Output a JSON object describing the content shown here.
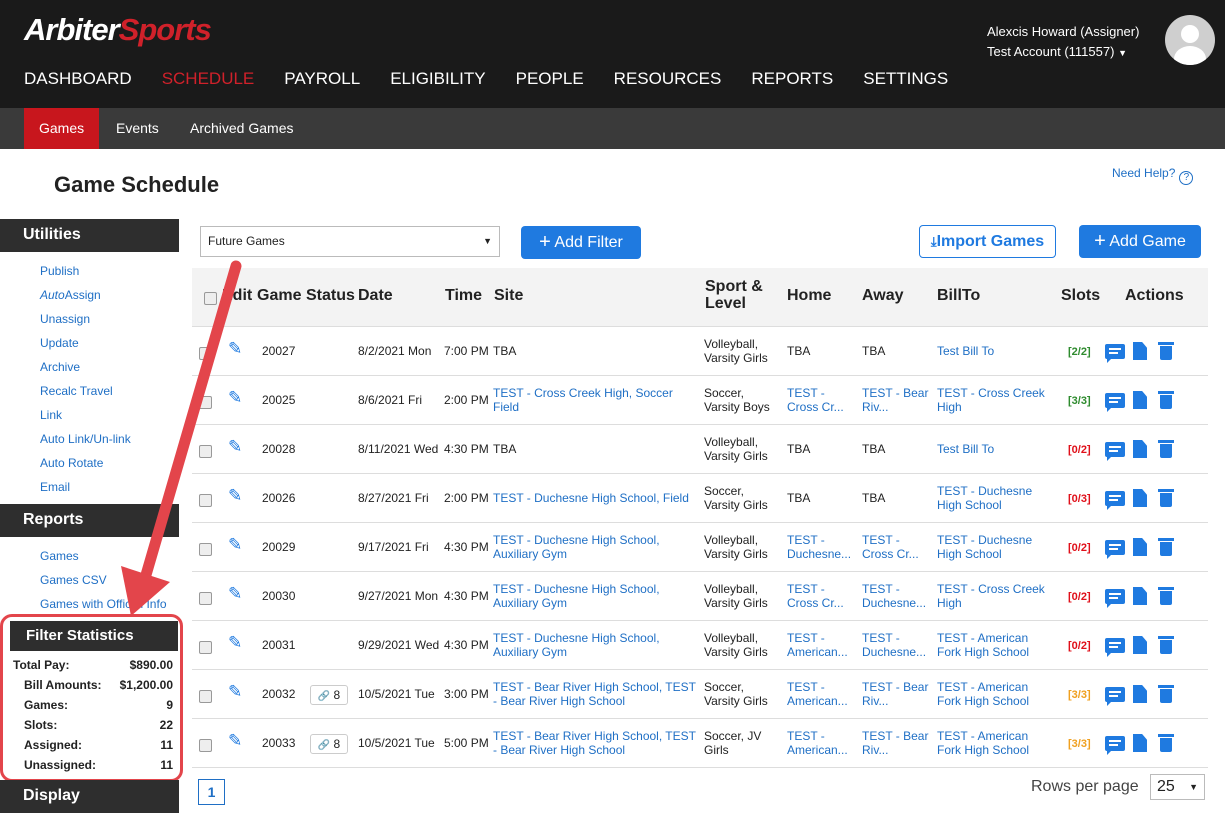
{
  "logo": {
    "arbiter": "Arbiter",
    "sports": "Sports"
  },
  "user": {
    "name": "Alexcis Howard (Assigner)",
    "account": "Test Account (111557)"
  },
  "nav": [
    "DASHBOARD",
    "SCHEDULE",
    "PAYROLL",
    "ELIGIBILITY",
    "PEOPLE",
    "RESOURCES",
    "REPORTS",
    "SETTINGS"
  ],
  "subnav": [
    "Games",
    "Events",
    "Archived Games"
  ],
  "page_title": "Game Schedule",
  "help": "Need Help?",
  "utilities": {
    "title": "Utilities",
    "items": [
      "Publish",
      "AutoAssign",
      "Unassign",
      "Update",
      "Archive",
      "Recalc Travel",
      "Link",
      "Auto Link/Un-link",
      "Auto Rotate",
      "Email"
    ]
  },
  "reports": {
    "title": "Reports",
    "items": [
      "Games",
      "Games CSV",
      "Games with Official Info"
    ]
  },
  "stats": {
    "title": "Filter Statistics",
    "rows": [
      {
        "label": "Total Pay:",
        "value": "$890.00"
      },
      {
        "label": "Bill Amounts:",
        "value": "$1,200.00"
      },
      {
        "label": "Games:",
        "value": "9"
      },
      {
        "label": "Slots:",
        "value": "22"
      },
      {
        "label": "Assigned:",
        "value": "11"
      },
      {
        "label": "Unassigned:",
        "value": "11"
      }
    ]
  },
  "display": "Display",
  "filter": {
    "selected": "Future Games",
    "add_filter": "Add Filter",
    "import_games": "Import Games",
    "add_game": "Add Game"
  },
  "columns": [
    "Edit",
    "Game",
    "Status",
    "Date",
    "Time",
    "Site",
    "Sport & Level",
    "Home",
    "Away",
    "BillTo",
    "Slots",
    "Actions"
  ],
  "rows": [
    {
      "game": "20027",
      "status": "",
      "date": "8/2/2021 Mon",
      "time": "7:00 PM",
      "site": "TBA",
      "site_link": false,
      "sport": "Volleyball, Varsity Girls",
      "home": "TBA",
      "home_link": false,
      "away": "TBA",
      "away_link": false,
      "billto": "Test Bill To",
      "slots": "[2/2]",
      "slots_color": "#2e8b2e"
    },
    {
      "game": "20025",
      "status": "",
      "date": "8/6/2021 Fri",
      "time": "2:00 PM",
      "site": "TEST - Cross Creek High, Soccer Field",
      "site_link": true,
      "sport": "Soccer, Varsity Boys",
      "home": "TEST - Cross Cr...",
      "home_link": true,
      "away": "TEST - Bear Riv...",
      "away_link": true,
      "billto": "TEST - Cross Creek High",
      "slots": "[3/3]",
      "slots_color": "#2e8b2e"
    },
    {
      "game": "20028",
      "status": "",
      "date": "8/11/2021 Wed",
      "time": "4:30 PM",
      "site": "TBA",
      "site_link": false,
      "sport": "Volleyball, Varsity Girls",
      "home": "TBA",
      "home_link": false,
      "away": "TBA",
      "away_link": false,
      "billto": "Test Bill To",
      "slots": "[0/2]",
      "slots_color": "#e0101a"
    },
    {
      "game": "20026",
      "status": "",
      "date": "8/27/2021 Fri",
      "time": "2:00 PM",
      "site": "TEST - Duchesne High School, Field",
      "site_link": true,
      "sport": "Soccer, Varsity Girls",
      "home": "TBA",
      "home_link": false,
      "away": "TBA",
      "away_link": false,
      "billto": "TEST - Duchesne High School",
      "slots": "[0/3]",
      "slots_color": "#e0101a"
    },
    {
      "game": "20029",
      "status": "",
      "date": "9/17/2021 Fri",
      "time": "4:30 PM",
      "site": "TEST - Duchesne High School, Auxiliary Gym",
      "site_link": true,
      "sport": "Volleyball, Varsity Girls",
      "home": "TEST - Duchesne...",
      "home_link": true,
      "away": "TEST - Cross Cr...",
      "away_link": true,
      "billto": "TEST - Duchesne High School",
      "slots": "[0/2]",
      "slots_color": "#e0101a"
    },
    {
      "game": "20030",
      "status": "",
      "date": "9/27/2021 Mon",
      "time": "4:30 PM",
      "site": "TEST - Duchesne High School, Auxiliary Gym",
      "site_link": true,
      "sport": "Volleyball, Varsity Girls",
      "home": "TEST - Cross Cr...",
      "home_link": true,
      "away": "TEST - Duchesne...",
      "away_link": true,
      "billto": "TEST - Cross Creek High",
      "slots": "[0/2]",
      "slots_color": "#e0101a"
    },
    {
      "game": "20031",
      "status": "",
      "date": "9/29/2021 Wed",
      "time": "4:30 PM",
      "site": "TEST - Duchesne High School, Auxiliary Gym",
      "site_link": true,
      "sport": "Volleyball, Varsity Girls",
      "home": "TEST - American...",
      "home_link": true,
      "away": "TEST - Duchesne...",
      "away_link": true,
      "billto": "TEST - American Fork High School",
      "slots": "[0/2]",
      "slots_color": "#e0101a"
    },
    {
      "game": "20032",
      "status": "8",
      "date": "10/5/2021 Tue",
      "time": "3:00 PM",
      "site": "TEST - Bear River High School, TEST - Bear River High School",
      "site_link": true,
      "sport": "Soccer, Varsity Girls",
      "home": "TEST - American...",
      "home_link": true,
      "away": "TEST - Bear Riv...",
      "away_link": true,
      "billto": "TEST - American Fork High School",
      "slots": "[3/3]",
      "slots_color": "#f0a020"
    },
    {
      "game": "20033",
      "status": "8",
      "date": "10/5/2021 Tue",
      "time": "5:00 PM",
      "site": "TEST - Bear River High School, TEST - Bear River High School",
      "site_link": true,
      "sport": "Soccer, JV Girls",
      "home": "TEST - American...",
      "home_link": true,
      "away": "TEST - Bear Riv...",
      "away_link": true,
      "billto": "TEST - American Fork High School",
      "slots": "[3/3]",
      "slots_color": "#f0a020"
    }
  ],
  "pagination": {
    "page": "1",
    "rows_per_page_label": "Rows per page",
    "rows_per_page": "25"
  }
}
